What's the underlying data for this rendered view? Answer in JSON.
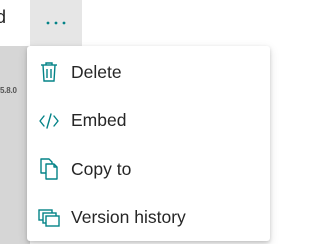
{
  "background": {
    "partial_text": "d",
    "tiny_label": "5.8.0"
  },
  "more_button": {
    "label": "···",
    "icon": "ellipsis-icon"
  },
  "menu": {
    "accent_color": "#038387",
    "items": [
      {
        "label": "Delete",
        "icon": "trash-icon"
      },
      {
        "label": "Embed",
        "icon": "code-icon"
      },
      {
        "label": "Copy to",
        "icon": "copy-icon"
      },
      {
        "label": "Version history",
        "icon": "version-history-icon"
      }
    ]
  }
}
